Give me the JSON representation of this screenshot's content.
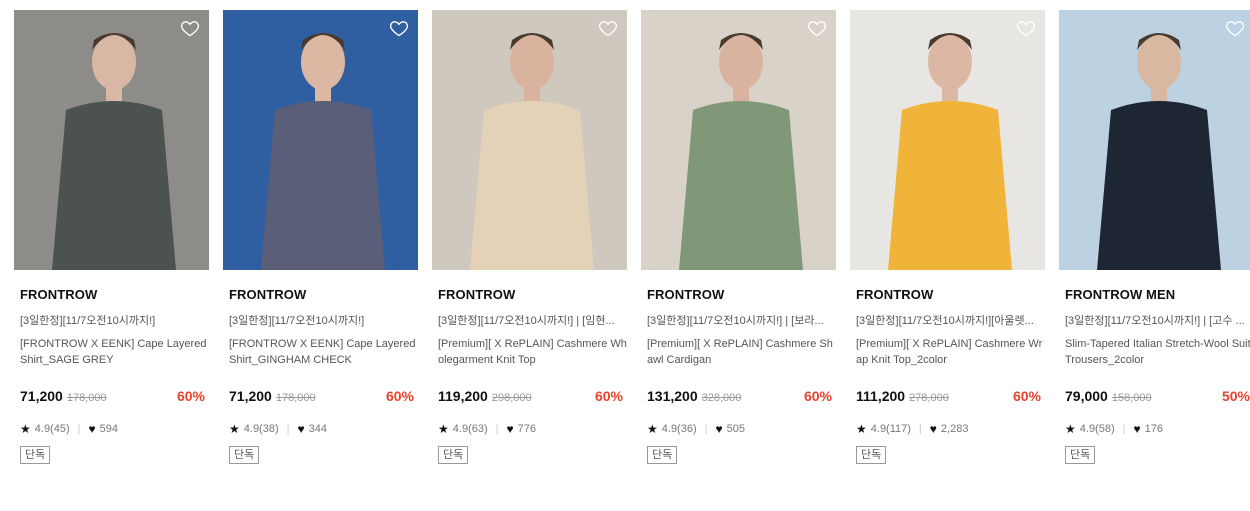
{
  "products": [
    {
      "brand": "FRONTROW",
      "promo": "[3일한정][11/7오전10시까지!]",
      "name": "[FRONTROW X EENK] Cape Layered Shirt_SAGE GREY",
      "price": "71,200",
      "original_price": "178,000",
      "discount": "60%",
      "rating": "4.9(45)",
      "likes": "594",
      "badge": "단독",
      "image_palette": {
        "bg": "#8e8c88",
        "figure": "#4c5250",
        "skin": "#d8b8a4"
      }
    },
    {
      "brand": "FRONTROW",
      "promo": "[3일한정][11/7오전10시까지!]",
      "name": "[FRONTROW X EENK] Cape Layered Shirt_GINGHAM CHECK",
      "price": "71,200",
      "original_price": "178,000",
      "discount": "60%",
      "rating": "4.9(38)",
      "likes": "344",
      "badge": "단독",
      "image_palette": {
        "bg": "#2f5fa0",
        "figure": "#5a5e78",
        "skin": "#dcb8a2"
      }
    },
    {
      "brand": "FRONTROW",
      "promo": "[3일한정][11/7오전10시까지!] | [임현...",
      "name": "[Premium][ X RePLAIN] Cashmere Wholegarment Knit Top",
      "price": "119,200",
      "original_price": "298,000",
      "discount": "60%",
      "rating": "4.9(63)",
      "likes": "776",
      "badge": "단독",
      "image_palette": {
        "bg": "#cfc8be",
        "figure": "#e3d2b8",
        "skin": "#d9b39e"
      }
    },
    {
      "brand": "FRONTROW",
      "promo": "[3일한정][11/7오전10시까지!] | [보라...",
      "name": "[Premium][ X RePLAIN] Cashmere Shawl Cardigan",
      "price": "131,200",
      "original_price": "328,000",
      "discount": "60%",
      "rating": "4.9(36)",
      "likes": "505",
      "badge": "단독",
      "image_palette": {
        "bg": "#d8d2c8",
        "figure": "#809878",
        "skin": "#d8b4a0"
      }
    },
    {
      "brand": "FRONTROW",
      "promo": "[3일한정][11/7오전10시까지!][아울렛...",
      "name": "[Premium][ X RePLAIN] Cashmere Wrap Knit Top_2color",
      "price": "111,200",
      "original_price": "278,000",
      "discount": "60%",
      "rating": "4.9(117)",
      "likes": "2,283",
      "badge": "단독",
      "image_palette": {
        "bg": "#e8e6e2",
        "figure": "#f0b43a",
        "skin": "#dcb8a4"
      }
    },
    {
      "brand": "FRONTROW MEN",
      "promo": "[3일한정][11/7오전10시까지!] | [고수 ...",
      "name": "Slim-Tapered Italian Stretch-Wool Suit Trousers_2color",
      "price": "79,000",
      "original_price": "158,000",
      "discount": "50%",
      "rating": "4.9(58)",
      "likes": "176",
      "badge": "단독",
      "image_palette": {
        "bg": "#bcd2e2",
        "figure": "#1e2634",
        "skin": "#d8b8a0"
      }
    }
  ],
  "icons": {
    "wishlist": "heart-outline-icon",
    "rating": "star-icon",
    "likes": "heart-filled-icon"
  },
  "colors": {
    "discount": "#e8432c",
    "text": "#111111",
    "muted": "#999999"
  }
}
